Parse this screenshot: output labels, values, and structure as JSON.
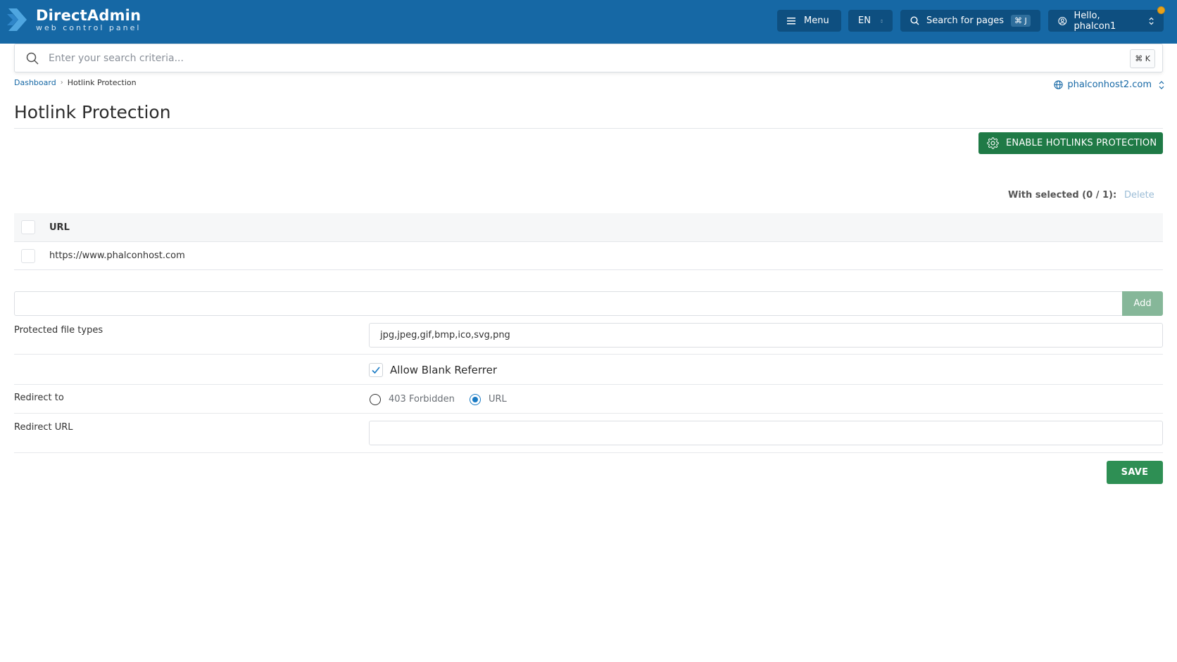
{
  "brand": {
    "title": "DirectAdmin",
    "subtitle": "web control panel"
  },
  "header": {
    "menu_label": "Menu",
    "language": "EN",
    "search_label": "Search for pages",
    "search_shortcut": "⌘ J",
    "user_label": "Hello, phalcon1"
  },
  "search": {
    "placeholder": "Enter your search criteria...",
    "shortcut": "⌘ K"
  },
  "breadcrumb": {
    "home": "Dashboard",
    "current": "Hotlink Protection"
  },
  "domain_selector": "phalconhost2.com",
  "page": {
    "title": "Hotlink Protection",
    "enable_button": "ENABLE HOTLINKS PROTECTION"
  },
  "table": {
    "with_selected": "With selected (0 / 1):",
    "delete_label": "Delete",
    "column_url": "URL",
    "rows": [
      {
        "url": "https://www.phalconhost.com",
        "selected": false
      }
    ]
  },
  "add": {
    "value": "",
    "button_label": "Add"
  },
  "form": {
    "protected_label": "Protected file types",
    "protected_value": "jpg,jpeg,gif,bmp,ico,svg,png",
    "allow_blank_label": "Allow Blank Referrer",
    "allow_blank_checked": true,
    "redirect_label": "Redirect to",
    "redirect_options": [
      "403 Forbidden",
      "URL"
    ],
    "redirect_selected": "URL",
    "redirect_url_label": "Redirect URL",
    "redirect_url_value": "",
    "save_label": "SAVE"
  },
  "colors": {
    "header_bg": "#1668a5",
    "primary_green": "#1f7a46",
    "accent_blue": "#1a7bc4"
  }
}
